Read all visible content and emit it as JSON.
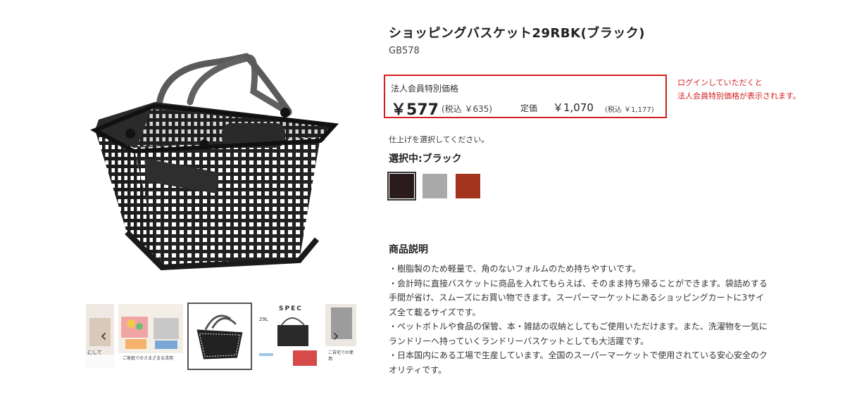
{
  "product": {
    "title": "ショッピングバスケット29RBK(ブラック)",
    "sku": "GB578"
  },
  "price": {
    "member_label": "法人会員特別価格",
    "member_price": "￥577",
    "member_tax": "(税込 ￥635)",
    "list_label": "定価",
    "list_price": "￥1,070",
    "list_tax": "(税込 ￥1,177)"
  },
  "login_note": {
    "line1": "ログインしていただくと",
    "line2": "法人会員特別価格が表示されます。"
  },
  "options": {
    "hint": "仕上げを選択してください。",
    "selected_label": "選択中:ブラック",
    "swatches": [
      {
        "name": "black",
        "color": "#2a1c1c"
      },
      {
        "name": "gray",
        "color": "#a9a9a9"
      },
      {
        "name": "red",
        "color": "#a3351f"
      }
    ]
  },
  "description": {
    "heading": "商品説明",
    "lines": [
      "・樹脂製のため軽量で、角のないフォルムのため持ちやすいです。",
      "・会計時に直接バスケットに商品を入れてもらえば、そのまま持ち帰ることができます。袋詰めする手間が省け、スムーズにお買い物できます。スーパーマーケットにあるショッピングカートに3サイズ全て載るサイズです。",
      "・ペットボトルや食品の保管、本・雑誌の収納としてもご使用いただけます。また、洗濯物を一気にランドリーへ持っていくランドリーバスケットとしても大活躍です。",
      "・日本国内にある工場で生産しています。全国のスーパーマーケットで使用されている安心安全のクオリティです。"
    ]
  },
  "gallery": {
    "prev_arrow": "‹",
    "next_arrow": "›",
    "spec_title": "SPEC",
    "spec_size": "29L",
    "thumb_texts": [
      "にして",
      "ご家庭でのさまざまな活用",
      "ご自宅での使用"
    ]
  },
  "colors": {
    "accent_red": "#d21f1f",
    "basket": "#1f1f1f",
    "handle": "#5a5a5a"
  },
  "icons": {
    "prev": "chevron-left-icon",
    "next": "chevron-right-icon"
  }
}
